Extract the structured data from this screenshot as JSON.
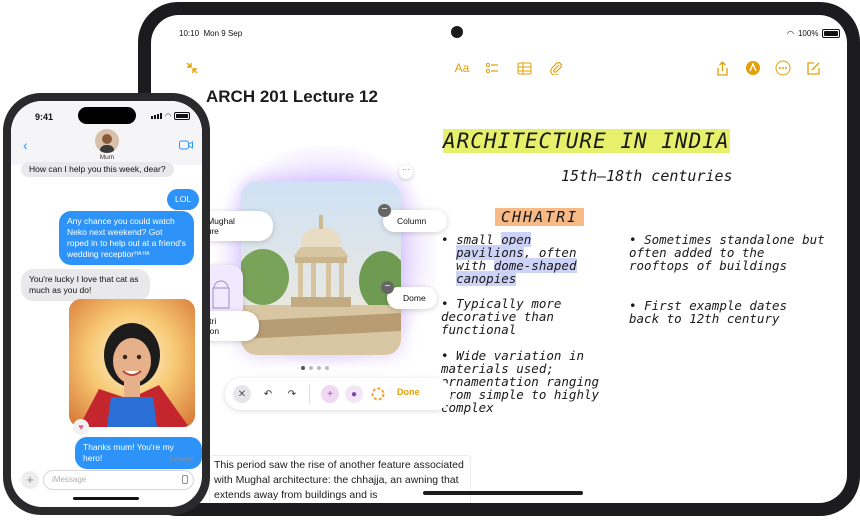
{
  "ipad": {
    "status": {
      "time": "10:10",
      "date": "Mon 9 Sep",
      "battery": "100%"
    },
    "toolbar": {
      "format_label": "Aa"
    },
    "note": {
      "title": "ARCH 201 Lecture 12",
      "heading": "ARCHITECTURE IN INDIA",
      "subheading": "15th–18th centuries",
      "section": "CHHATRI",
      "bullets_left": [
        {
          "l1a": "small ",
          "l1b": "open",
          "l2a": "pavilions",
          "l2b": ", often",
          "l3a": "with ",
          "l3b": "dome-shaped",
          "l4a": "canopies"
        },
        {
          "text": "Typically more decorative than functional"
        },
        {
          "text": "Wide variation in materials used; ornamentation ranging from simple to highly complex"
        }
      ],
      "bullets_right": [
        "Sometimes standalone but often added to the rooftops of buildings",
        "First example dates back to 12th century"
      ],
      "body_text": "This period saw the rise of another feature associated with Mughal architecture: the chhajja, an awning that extends away from buildings and is"
    },
    "playground": {
      "chips": {
        "left_top": "ient Mughal\nitecture",
        "left_bottom": "hhatri\navilion",
        "column": "Column",
        "dome": "Dome"
      },
      "toolbar": {
        "done_label": "Done"
      }
    },
    "icons": [
      "collapse-icon",
      "text-format-icon",
      "checklist-icon",
      "table-icon",
      "attachment-icon",
      "share-icon",
      "markup-icon",
      "more-icon",
      "compose-icon"
    ]
  },
  "iphone": {
    "status": {
      "time": "9:41"
    },
    "contact": {
      "name": "Mum"
    },
    "messages": [
      {
        "from": "in",
        "text": "How can I help you this week, dear?"
      },
      {
        "from": "out",
        "text": "LOL"
      },
      {
        "from": "out",
        "text": "Any chance you could watch Neko next weekend? Got roped in to help out at a friend's wedding reception"
      },
      {
        "from": "in",
        "text": "You're lucky I love that cat as much as you do!"
      },
      {
        "from": "out",
        "text": "Thanks mum! You're my hero!"
      }
    ],
    "tapback": "HA HA",
    "delivered": "Delivered",
    "input": {
      "placeholder": "iMessage"
    }
  },
  "colors": {
    "accent_yellow": "#e3a008",
    "imessage_blue": "#2e93f8",
    "highlight_yellow": "#e6f06a",
    "highlight_orange": "#f7b985"
  }
}
